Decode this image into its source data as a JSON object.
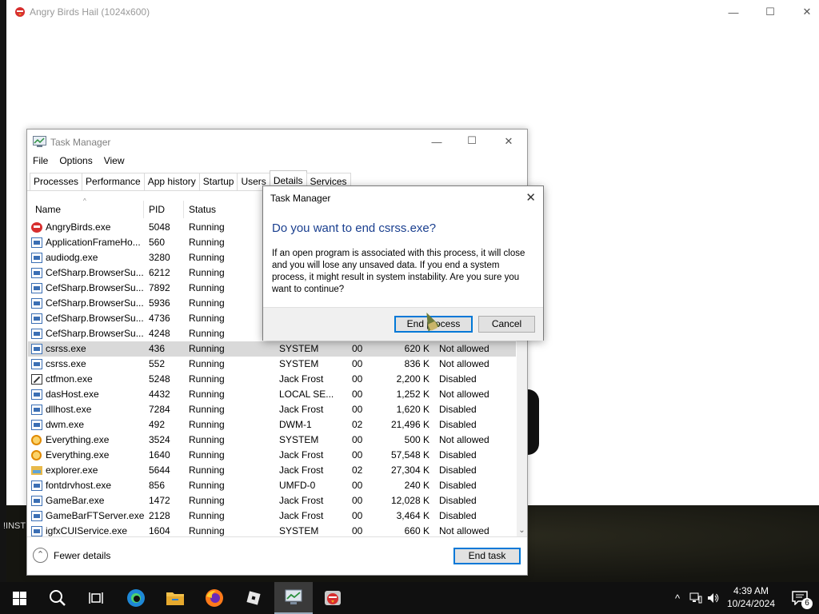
{
  "game_window": {
    "title": "Angry Birds Hail (1024x600)",
    "controls": {
      "minimize": "—",
      "maximize": "☐",
      "close": "✕"
    },
    "bottom_text": "!INST"
  },
  "task_manager": {
    "title": "Task Manager",
    "controls": {
      "minimize": "—",
      "maximize": "☐",
      "close": "✕"
    },
    "menu": [
      "File",
      "Options",
      "View"
    ],
    "tabs": [
      "Processes",
      "Performance",
      "App history",
      "Startup",
      "Users",
      "Details",
      "Services"
    ],
    "active_tab": "Details",
    "columns": {
      "name": "Name",
      "pid": "PID",
      "status": "Status"
    },
    "rows": [
      {
        "icon": "angry-birds-icon",
        "name": "AngryBirds.exe",
        "pid": "5048",
        "status": "Running",
        "user": "",
        "cpu": "",
        "mem": "",
        "uac": ""
      },
      {
        "icon": "app-icon",
        "name": "ApplicationFrameHo...",
        "pid": "560",
        "status": "Running",
        "user": "",
        "cpu": "",
        "mem": "",
        "uac": ""
      },
      {
        "icon": "app-icon",
        "name": "audiodg.exe",
        "pid": "3280",
        "status": "Running",
        "user": "",
        "cpu": "",
        "mem": "",
        "uac": ""
      },
      {
        "icon": "app-icon",
        "name": "CefSharp.BrowserSu...",
        "pid": "6212",
        "status": "Running",
        "user": "",
        "cpu": "",
        "mem": "",
        "uac": ""
      },
      {
        "icon": "app-icon",
        "name": "CefSharp.BrowserSu...",
        "pid": "7892",
        "status": "Running",
        "user": "",
        "cpu": "",
        "mem": "",
        "uac": ""
      },
      {
        "icon": "app-icon",
        "name": "CefSharp.BrowserSu...",
        "pid": "5936",
        "status": "Running",
        "user": "",
        "cpu": "",
        "mem": "",
        "uac": ""
      },
      {
        "icon": "app-icon",
        "name": "CefSharp.BrowserSu...",
        "pid": "4736",
        "status": "Running",
        "user": "",
        "cpu": "",
        "mem": "",
        "uac": ""
      },
      {
        "icon": "app-icon",
        "name": "CefSharp.BrowserSu...",
        "pid": "4248",
        "status": "Running",
        "user": "",
        "cpu": "",
        "mem": "",
        "uac": ""
      },
      {
        "icon": "app-icon",
        "name": "csrss.exe",
        "pid": "436",
        "status": "Running",
        "user": "SYSTEM",
        "cpu": "00",
        "mem": "620 K",
        "uac": "Not allowed",
        "selected": true
      },
      {
        "icon": "app-icon",
        "name": "csrss.exe",
        "pid": "552",
        "status": "Running",
        "user": "SYSTEM",
        "cpu": "00",
        "mem": "836 K",
        "uac": "Not allowed"
      },
      {
        "icon": "pen-icon",
        "name": "ctfmon.exe",
        "pid": "5248",
        "status": "Running",
        "user": "Jack Frost",
        "cpu": "00",
        "mem": "2,200 K",
        "uac": "Disabled"
      },
      {
        "icon": "app-icon",
        "name": "dasHost.exe",
        "pid": "4432",
        "status": "Running",
        "user": "LOCAL SE...",
        "cpu": "00",
        "mem": "1,252 K",
        "uac": "Not allowed"
      },
      {
        "icon": "app-icon",
        "name": "dllhost.exe",
        "pid": "7284",
        "status": "Running",
        "user": "Jack Frost",
        "cpu": "00",
        "mem": "1,620 K",
        "uac": "Disabled"
      },
      {
        "icon": "app-icon",
        "name": "dwm.exe",
        "pid": "492",
        "status": "Running",
        "user": "DWM-1",
        "cpu": "02",
        "mem": "21,496 K",
        "uac": "Disabled"
      },
      {
        "icon": "magnifier-icon",
        "name": "Everything.exe",
        "pid": "3524",
        "status": "Running",
        "user": "SYSTEM",
        "cpu": "00",
        "mem": "500 K",
        "uac": "Not allowed"
      },
      {
        "icon": "magnifier-icon",
        "name": "Everything.exe",
        "pid": "1640",
        "status": "Running",
        "user": "Jack Frost",
        "cpu": "00",
        "mem": "57,548 K",
        "uac": "Disabled"
      },
      {
        "icon": "folder-icon",
        "name": "explorer.exe",
        "pid": "5644",
        "status": "Running",
        "user": "Jack Frost",
        "cpu": "02",
        "mem": "27,304 K",
        "uac": "Disabled"
      },
      {
        "icon": "app-icon",
        "name": "fontdrvhost.exe",
        "pid": "856",
        "status": "Running",
        "user": "UMFD-0",
        "cpu": "00",
        "mem": "240 K",
        "uac": "Disabled"
      },
      {
        "icon": "app-icon",
        "name": "GameBar.exe",
        "pid": "1472",
        "status": "Running",
        "user": "Jack Frost",
        "cpu": "00",
        "mem": "12,028 K",
        "uac": "Disabled"
      },
      {
        "icon": "app-icon",
        "name": "GameBarFTServer.exe",
        "pid": "2128",
        "status": "Running",
        "user": "Jack Frost",
        "cpu": "00",
        "mem": "3,464 K",
        "uac": "Disabled"
      },
      {
        "icon": "app-icon",
        "name": "igfxCUIService.exe",
        "pid": "1604",
        "status": "Running",
        "user": "SYSTEM",
        "cpu": "00",
        "mem": "660 K",
        "uac": "Not allowed"
      }
    ],
    "fewer_details": "Fewer details",
    "end_task": "End task"
  },
  "dialog": {
    "title": "Task Manager",
    "close": "✕",
    "heading": "Do you want to end csrss.exe?",
    "body": "If an open program is associated with this process, it will close and you will lose any unsaved data. If you end a system process, it might result in system instability. Are you sure you want to continue?",
    "end_button": "End process",
    "cancel_button": "Cancel"
  },
  "taskbar": {
    "apps": [
      "start-icon",
      "search-icon",
      "task-view-icon",
      "edge-icon",
      "file-explorer-icon",
      "firefox-icon",
      "roblox-icon",
      "task-manager-icon",
      "angry-birds-icon"
    ],
    "time": "4:39 AM",
    "date": "10/24/2024",
    "notification_count": "6"
  }
}
